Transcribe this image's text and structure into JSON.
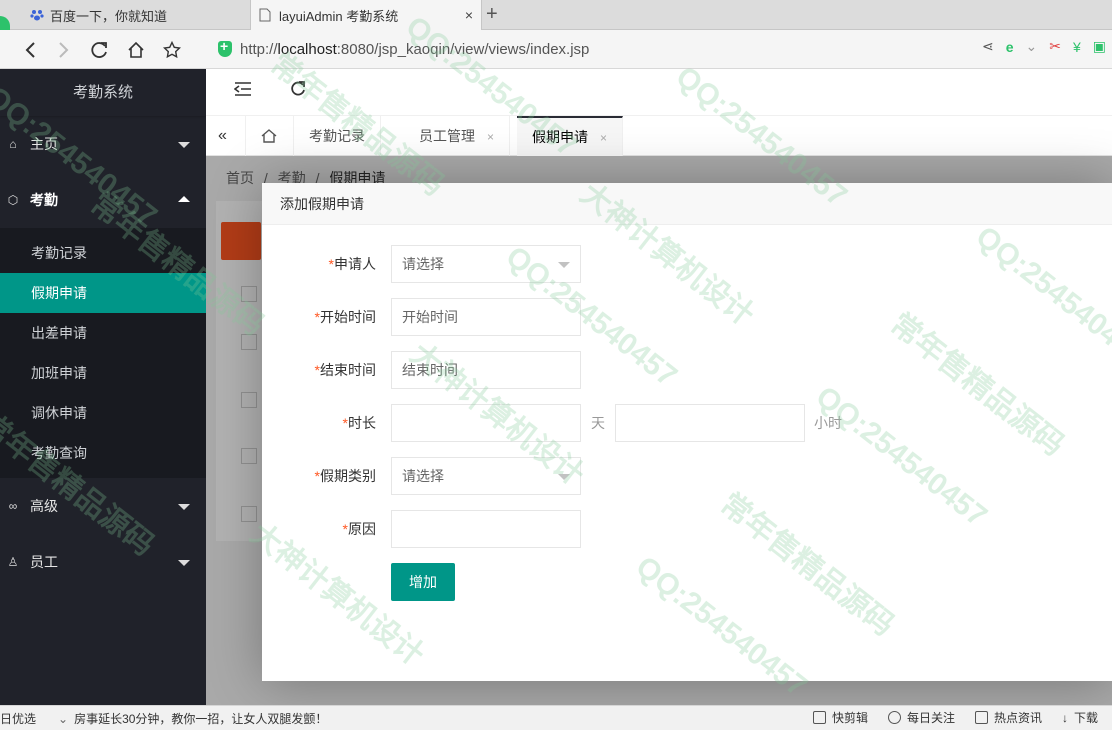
{
  "browser": {
    "tabs": [
      {
        "title": "百度一下，你就知道",
        "close": ""
      },
      {
        "title": "layuiAdmin 考勤系统",
        "close": "×"
      }
    ],
    "new_tab": "+",
    "url_prefix": "http://",
    "url_host": "localhost",
    "url_rest": ":8080/jsp_kaoqin/view/views/index.jsp"
  },
  "sidebar": {
    "logo": "考勤系统",
    "groups": [
      {
        "label": "主页",
        "icon": "⌂"
      },
      {
        "label": "考勤",
        "icon": "⬡"
      },
      {
        "label": "高级",
        "icon": "∞"
      },
      {
        "label": "员工",
        "icon": "♙"
      }
    ],
    "subitems": [
      "考勤记录",
      "假期申请",
      "出差申请",
      "加班申请",
      "调休申请",
      "考勤查询"
    ]
  },
  "page_tabs": [
    {
      "label": "考勤记录"
    },
    {
      "label": "员工管理",
      "close": "×"
    },
    {
      "label": "假期申请",
      "close": "×"
    }
  ],
  "breadcrumb": {
    "home": "首页",
    "sep": "/",
    "section": "考勤",
    "current": "假期申请"
  },
  "dialog": {
    "title": "添加假期申请",
    "required_mark": "*",
    "fields": {
      "applicant": {
        "label": "申请人",
        "placeholder": "请选择"
      },
      "start_time": {
        "label": "开始时间",
        "placeholder": "开始时间"
      },
      "end_time": {
        "label": "结束时间",
        "placeholder": "结束时间"
      },
      "duration": {
        "label": "时长",
        "day_unit": "天",
        "hour_unit": "小时"
      },
      "leave_type": {
        "label": "假期类别",
        "placeholder": "请选择"
      },
      "reason": {
        "label": "原因"
      }
    },
    "submit_label": "增加"
  },
  "statusbar": {
    "left": "日优选",
    "news": "房事延长30分钟，教你一招，让女人双腿发颤！",
    "items": [
      "快剪辑",
      "每日关注",
      "热点资讯",
      "下载"
    ]
  },
  "watermarks": [
    "QQ:254540457",
    "大神计算机设计",
    "常年售精品源码"
  ],
  "colors": {
    "accent": "#009688",
    "sidebar_bg": "#20222a",
    "danger": "#ff5722"
  }
}
